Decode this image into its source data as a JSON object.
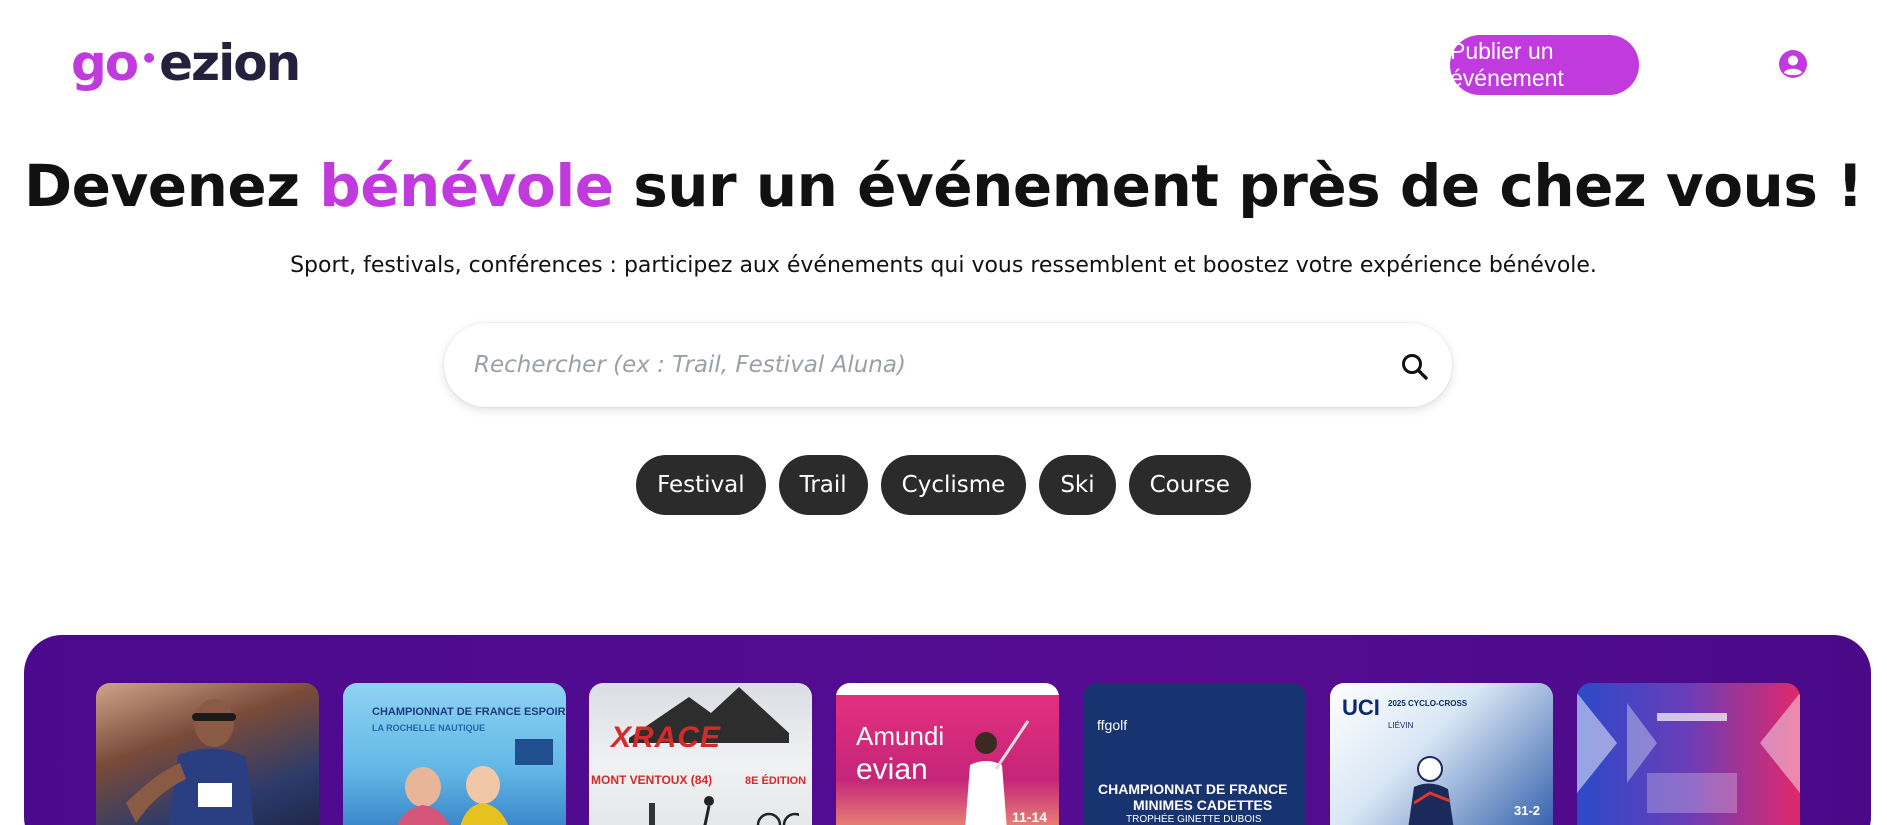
{
  "header": {
    "logo": {
      "part1": "go",
      "dot": "•",
      "part2": "ezion"
    },
    "publish_button": "Publier un événement",
    "user_icon": "user-circle-icon"
  },
  "hero": {
    "title_before": "Devenez ",
    "title_accent": "bénévole",
    "title_after": " sur un événement près de chez vous !",
    "subtitle": "Sport, festivals, conférences : participez aux événements qui vous ressemblent et boostez votre expérience bénévole."
  },
  "search": {
    "placeholder": "Rechercher (ex : Trail, Festival Aluna)",
    "icon": "search-icon"
  },
  "tags": [
    "Festival",
    "Trail",
    "Cyclisme",
    "Ski",
    "Course"
  ],
  "events": {
    "card2": {
      "line1": "CHAMPIONNAT DE FRANCE ESPOIRS",
      "line2": "LA ROCHELLE NAUTIQUE"
    },
    "card3": {
      "brand": "XRACE",
      "place": "MONT VENTOUX (84)",
      "edition": "8E ÉDITION"
    },
    "card4": {
      "brand": "Amundi",
      "sub": "evian",
      "date": "11-14"
    },
    "card5": {
      "org": "ffgolf",
      "line1": "CHAMPIONNAT DE FRANCE",
      "line2": "MINIMES CADETTES",
      "line3": "TROPHÉE GINETTE DUBOIS"
    },
    "card6": {
      "org": "UCI",
      "sub": "2025 CYCLO-CROSS",
      "location": "LIÉVIN",
      "date": "31-2"
    }
  },
  "colors": {
    "brand": "#c13add",
    "dark": "#25213d",
    "tag_bg": "#2b2b2b",
    "band": "#4b0a8e"
  }
}
